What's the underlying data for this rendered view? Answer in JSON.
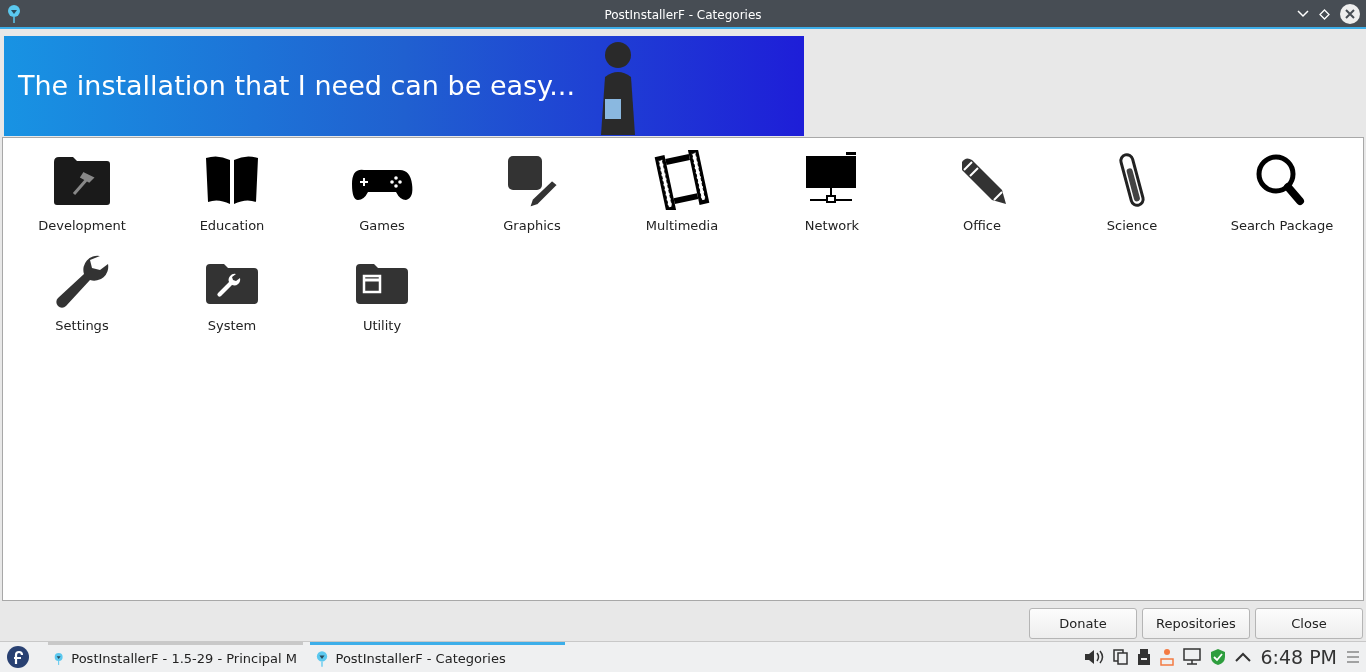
{
  "window": {
    "title": "PostInstallerF - Categories"
  },
  "banner": {
    "text": "The installation that I need can be easy..."
  },
  "categories": [
    {
      "label": "Development"
    },
    {
      "label": "Education"
    },
    {
      "label": "Games"
    },
    {
      "label": "Graphics"
    },
    {
      "label": "Multimedia"
    },
    {
      "label": "Network"
    },
    {
      "label": "Office"
    },
    {
      "label": "Science"
    },
    {
      "label": "Search Package"
    },
    {
      "label": "Settings"
    },
    {
      "label": "System"
    },
    {
      "label": "Utility"
    }
  ],
  "buttons": [
    "Donate",
    "Repositories",
    "Close"
  ],
  "taskbar": {
    "tasks": [
      {
        "label": "PostInstallerF - 1.5-29 - Principal M",
        "selected": false
      },
      {
        "label": "PostInstallerF - Categories",
        "selected": true
      }
    ],
    "clock": "6:48 PM"
  }
}
